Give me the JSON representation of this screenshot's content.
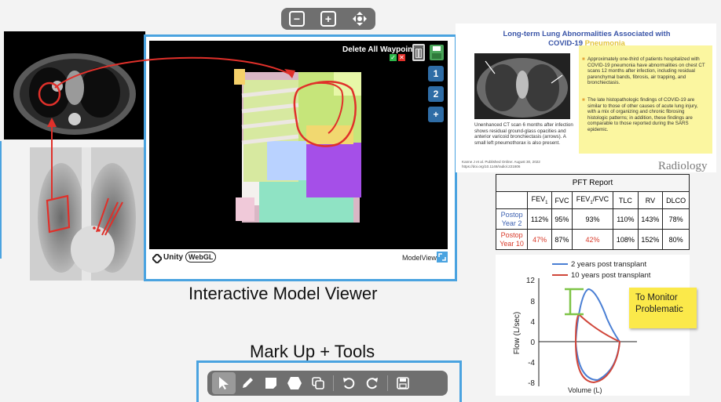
{
  "zoom_toolbar": {
    "zoom_out_icon": "minus-square-icon",
    "zoom_in_icon": "plus-square-icon",
    "pan_icon": "move-arrows-icon"
  },
  "viewer": {
    "delete_waypoints_label": "Delete All Waypoints?",
    "waypoints": [
      "1",
      "2",
      "+"
    ],
    "footer_logo_unity": "Unity",
    "footer_logo_webgl": "WebGL",
    "footer_title": "ModelViewer",
    "caption": "Interactive Model Viewer"
  },
  "tools": {
    "caption": "Mark Up + Tools",
    "items": [
      "pointer-icon",
      "pencil-icon",
      "note-icon",
      "hexagon-icon",
      "copy-icon",
      "undo-icon",
      "redo-icon",
      "save-icon"
    ],
    "active": "pointer-icon"
  },
  "paper": {
    "title_line1": "Long-term Lung Abnormalities Associated with",
    "title_line2_a": "COVID-19 ",
    "title_line2_b": "Pneumonia",
    "bullet1": "Approximately one-third of patients hospitalized with COVID-19 pneumonia have abnormalities on chest CT scans 12 months after infection, including residual parenchymal bands, fibrosis, air trapping, and bronchiectasis.",
    "bullet2": "The late histopathologic findings of COVID-19 are similar to those of other causes of acute lung injury, with a mix of organizing and chronic fibrosing histologic patterns; in addition, these findings are comparable to those reported during the SARS epidemic.",
    "image_caption": "Unenhanced CT scan 6 months after infection shows residual ground-glass opacities and anterior varicoid bronchiectasis (arrows). A small left pneumothorax is also present.",
    "citation": "Kanne J et al. Published Online: August 30, 2022",
    "doi": "https://doi.org/10.1148/radiol.221806",
    "journal": "Radiology"
  },
  "pft": {
    "title": "PFT Report",
    "headers": [
      "",
      "FEV",
      "FVC",
      "FEV",
      "TLC",
      "RV",
      "DLCO"
    ],
    "fev_sub": "1",
    "fev_ratio_suffix": "/FVC",
    "rows": [
      {
        "label_line1": "Postop",
        "label_line2": "Year 2",
        "label_color": "#3b5fb0",
        "values": [
          "112%",
          "95%",
          "93%",
          "110%",
          "143%",
          "78%"
        ]
      },
      {
        "label_line1": "Postop",
        "label_line2": "Year 10",
        "label_color": "#d83a2a",
        "values": [
          "47%",
          "87%",
          "42%",
          "108%",
          "152%",
          "80%"
        ]
      }
    ]
  },
  "sticky_note": {
    "line1": "To Monitor",
    "line2": "Problematic"
  },
  "chart_data": {
    "type": "line",
    "ylabel": "Flow (L/sec)",
    "xlabel": "Volume (L)",
    "yticks": [
      "12",
      "8",
      "4",
      "0",
      "-4",
      "-8"
    ],
    "ylim": [
      -9,
      13
    ],
    "series": [
      {
        "name": "2 years post transplant",
        "color": "#4a7fd4"
      },
      {
        "name": "10 years post transplant",
        "color": "#d0463a"
      }
    ]
  },
  "colors": {
    "accent_blue": "#4aa3e0",
    "annotation_red": "#e0302a",
    "toolbar_gray": "#6f6f6f"
  }
}
